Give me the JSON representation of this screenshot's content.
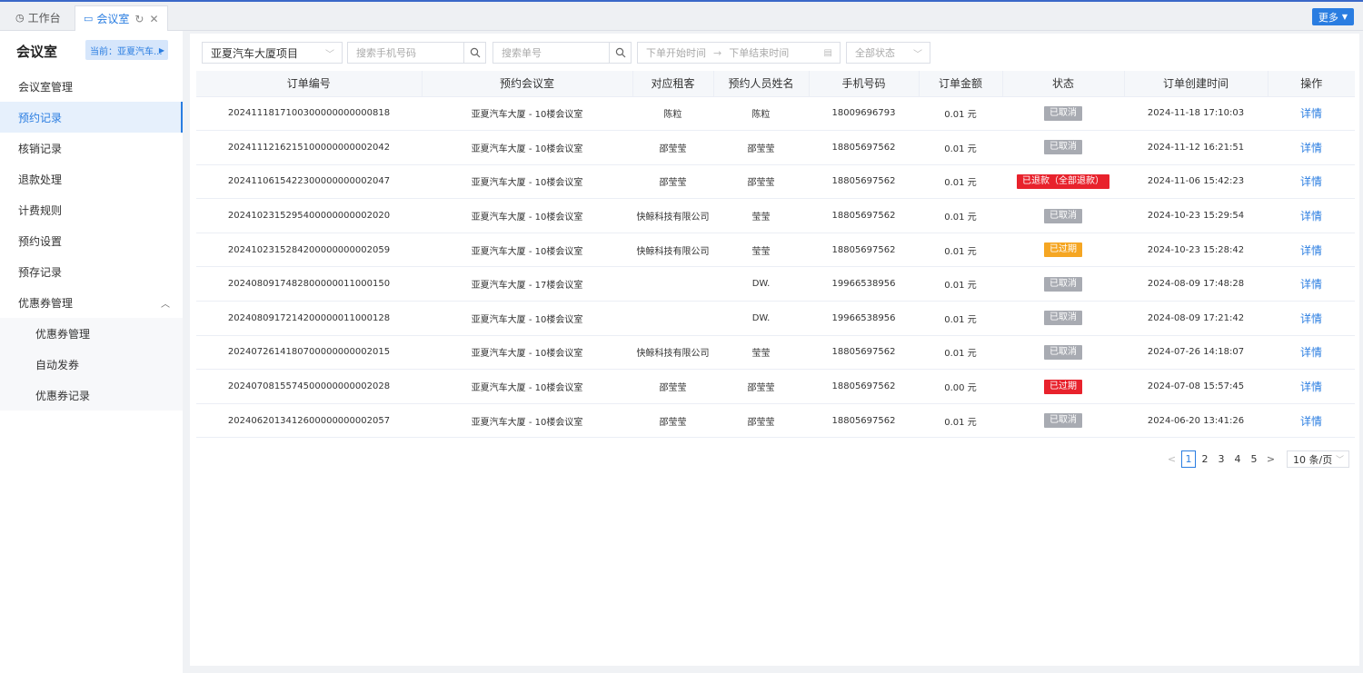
{
  "tabs": [
    {
      "label": "工作台",
      "icon": "dashboard-icon"
    },
    {
      "label": "会议室",
      "icon": "monitor-icon"
    }
  ],
  "more_label": "更多",
  "sidebar": {
    "title": "会议室",
    "project_badge": "当前：亚夏汽车...",
    "items": [
      {
        "label": "会议室管理"
      },
      {
        "label": "预约记录",
        "active": true
      },
      {
        "label": "核销记录"
      },
      {
        "label": "退款处理"
      },
      {
        "label": "计费规则"
      },
      {
        "label": "预约设置"
      },
      {
        "label": "预存记录"
      },
      {
        "label": "优惠券管理",
        "expanded": true
      }
    ],
    "sub_items": [
      {
        "label": "优惠券管理"
      },
      {
        "label": "自动发券"
      },
      {
        "label": "优惠券记录"
      }
    ]
  },
  "filters": {
    "project": "亚夏汽车大厦项目",
    "phone_placeholder": "搜索手机号码",
    "order_placeholder": "搜索单号",
    "start_placeholder": "下单开始时间",
    "end_placeholder": "下单结束时间",
    "status": "全部状态"
  },
  "table": {
    "columns": [
      "订单编号",
      "预约会议室",
      "对应租客",
      "预约人员姓名",
      "手机号码",
      "订单金额",
      "状态",
      "订单创建时间",
      "操作"
    ],
    "rows": [
      {
        "order": "2024111817100300000000000818",
        "room": "亚夏汽车大厦 - 10楼会议室",
        "tenant": "陈粒",
        "person": "陈粒",
        "phone": "18009696793",
        "amount": "0.01 元",
        "status": "已取消",
        "status_color": "#a8abb2",
        "created": "2024-11-18 17:10:03",
        "action": "详情"
      },
      {
        "order": "2024111216215100000000002042",
        "room": "亚夏汽车大厦 - 10楼会议室",
        "tenant": "邵莹莹",
        "person": "邵莹莹",
        "phone": "18805697562",
        "amount": "0.01 元",
        "status": "已取消",
        "status_color": "#a8abb2",
        "created": "2024-11-12 16:21:51",
        "action": "详情"
      },
      {
        "order": "2024110615422300000000002047",
        "room": "亚夏汽车大厦 - 10楼会议室",
        "tenant": "邵莹莹",
        "person": "邵莹莹",
        "phone": "18805697562",
        "amount": "0.01 元",
        "status": "已退款（全部退款）",
        "status_color": "#e8222c",
        "created": "2024-11-06 15:42:23",
        "action": "详情"
      },
      {
        "order": "2024102315295400000000002020",
        "room": "亚夏汽车大厦 - 10楼会议室",
        "tenant": "快鲸科技有限公司",
        "person": "莹莹",
        "phone": "18805697562",
        "amount": "0.01 元",
        "status": "已取消",
        "status_color": "#a8abb2",
        "created": "2024-10-23 15:29:54",
        "action": "详情"
      },
      {
        "order": "2024102315284200000000002059",
        "room": "亚夏汽车大厦 - 10楼会议室",
        "tenant": "快鲸科技有限公司",
        "person": "莹莹",
        "phone": "18805697562",
        "amount": "0.01 元",
        "status": "已过期",
        "status_color": "#f5a623",
        "created": "2024-10-23 15:28:42",
        "action": "详情"
      },
      {
        "order": "2024080917482800000011000150",
        "room": "亚夏汽车大厦 - 17楼会议室",
        "tenant": "",
        "person": "DW.",
        "phone": "19966538956",
        "amount": "0.01 元",
        "status": "已取消",
        "status_color": "#a8abb2",
        "created": "2024-08-09 17:48:28",
        "action": "详情"
      },
      {
        "order": "2024080917214200000011000128",
        "room": "亚夏汽车大厦 - 10楼会议室",
        "tenant": "",
        "person": "DW.",
        "phone": "19966538956",
        "amount": "0.01 元",
        "status": "已取消",
        "status_color": "#a8abb2",
        "created": "2024-08-09 17:21:42",
        "action": "详情"
      },
      {
        "order": "2024072614180700000000002015",
        "room": "亚夏汽车大厦 - 10楼会议室",
        "tenant": "快鲸科技有限公司",
        "person": "莹莹",
        "phone": "18805697562",
        "amount": "0.01 元",
        "status": "已取消",
        "status_color": "#a8abb2",
        "created": "2024-07-26 14:18:07",
        "action": "详情"
      },
      {
        "order": "2024070815574500000000002028",
        "room": "亚夏汽车大厦 - 10楼会议室",
        "tenant": "邵莹莹",
        "person": "邵莹莹",
        "phone": "18805697562",
        "amount": "0.00 元",
        "status": "已过期",
        "status_color": "#e8222c",
        "created": "2024-07-08 15:57:45",
        "action": "详情"
      },
      {
        "order": "2024062013412600000000002057",
        "room": "亚夏汽车大厦 - 10楼会议室",
        "tenant": "邵莹莹",
        "person": "邵莹莹",
        "phone": "18805697562",
        "amount": "0.01 元",
        "status": "已取消",
        "status_color": "#a8abb2",
        "created": "2024-06-20 13:41:26",
        "action": "详情"
      }
    ]
  },
  "pagination": {
    "prev": "<",
    "next": ">",
    "pages": [
      "1",
      "2",
      "3",
      "4",
      "5"
    ],
    "current": "1",
    "page_size": "10 条/页"
  }
}
